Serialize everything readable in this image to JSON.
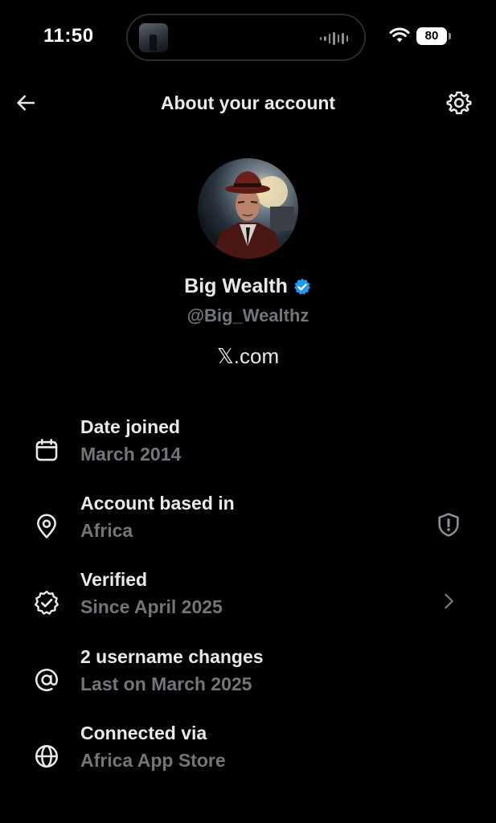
{
  "status_bar": {
    "time": "11:50",
    "battery": "80",
    "icons": [
      "now-playing-thumbnail",
      "audio-waveform-icon",
      "wifi-icon",
      "battery-icon"
    ]
  },
  "header": {
    "title": "About your account",
    "back_icon": "arrow-left-icon",
    "settings_icon": "gear-icon"
  },
  "profile": {
    "name": "Big Wealth",
    "handle": "@Big_Wealthz",
    "site": "𝕏.com",
    "verified_badge_color": "#1d9bf0"
  },
  "details": [
    {
      "title": "Date joined",
      "subtitle": "March 2014",
      "icon": "calendar-icon"
    },
    {
      "title": "Account based in",
      "subtitle": "Africa",
      "icon": "location-pin-icon",
      "action_icon": "shield-alert-icon"
    },
    {
      "title": "Verified",
      "subtitle": "Since April 2025",
      "icon": "verified-badge-icon",
      "action_icon": "chevron-right-icon"
    },
    {
      "title": "2 username changes",
      "subtitle": "Last on March 2025",
      "icon": "at-sign-icon"
    },
    {
      "title": "Connected via",
      "subtitle": "Africa App Store",
      "icon": "globe-icon"
    }
  ],
  "colors": {
    "background": "#000000",
    "primary_text": "#e7e9ea",
    "secondary_text": "#71767b",
    "accent": "#1d9bf0"
  }
}
